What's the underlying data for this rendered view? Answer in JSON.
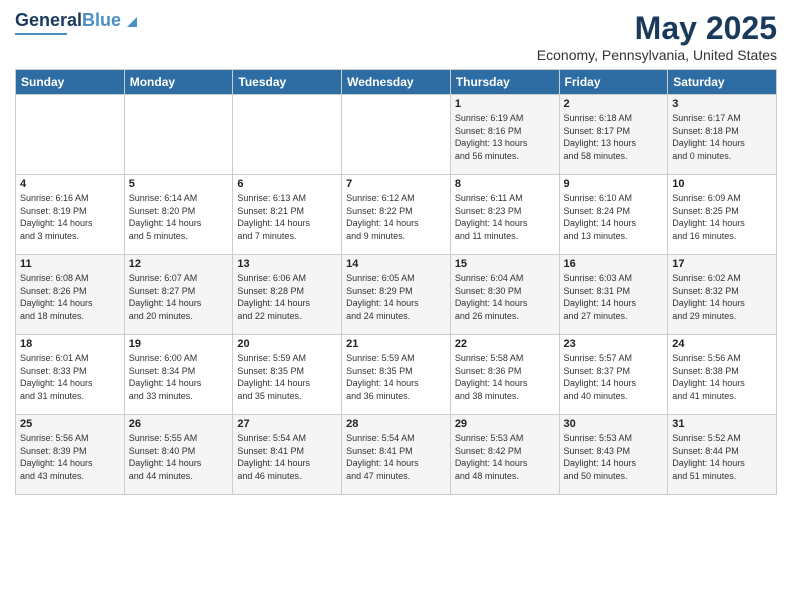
{
  "header": {
    "logo_general": "General",
    "logo_blue": "Blue",
    "month_title": "May 2025",
    "location": "Economy, Pennsylvania, United States"
  },
  "days_of_week": [
    "Sunday",
    "Monday",
    "Tuesday",
    "Wednesday",
    "Thursday",
    "Friday",
    "Saturday"
  ],
  "weeks": [
    [
      {
        "day": "",
        "info": ""
      },
      {
        "day": "",
        "info": ""
      },
      {
        "day": "",
        "info": ""
      },
      {
        "day": "",
        "info": ""
      },
      {
        "day": "1",
        "info": "Sunrise: 6:19 AM\nSunset: 8:16 PM\nDaylight: 13 hours\nand 56 minutes."
      },
      {
        "day": "2",
        "info": "Sunrise: 6:18 AM\nSunset: 8:17 PM\nDaylight: 13 hours\nand 58 minutes."
      },
      {
        "day": "3",
        "info": "Sunrise: 6:17 AM\nSunset: 8:18 PM\nDaylight: 14 hours\nand 0 minutes."
      }
    ],
    [
      {
        "day": "4",
        "info": "Sunrise: 6:16 AM\nSunset: 8:19 PM\nDaylight: 14 hours\nand 3 minutes."
      },
      {
        "day": "5",
        "info": "Sunrise: 6:14 AM\nSunset: 8:20 PM\nDaylight: 14 hours\nand 5 minutes."
      },
      {
        "day": "6",
        "info": "Sunrise: 6:13 AM\nSunset: 8:21 PM\nDaylight: 14 hours\nand 7 minutes."
      },
      {
        "day": "7",
        "info": "Sunrise: 6:12 AM\nSunset: 8:22 PM\nDaylight: 14 hours\nand 9 minutes."
      },
      {
        "day": "8",
        "info": "Sunrise: 6:11 AM\nSunset: 8:23 PM\nDaylight: 14 hours\nand 11 minutes."
      },
      {
        "day": "9",
        "info": "Sunrise: 6:10 AM\nSunset: 8:24 PM\nDaylight: 14 hours\nand 13 minutes."
      },
      {
        "day": "10",
        "info": "Sunrise: 6:09 AM\nSunset: 8:25 PM\nDaylight: 14 hours\nand 16 minutes."
      }
    ],
    [
      {
        "day": "11",
        "info": "Sunrise: 6:08 AM\nSunset: 8:26 PM\nDaylight: 14 hours\nand 18 minutes."
      },
      {
        "day": "12",
        "info": "Sunrise: 6:07 AM\nSunset: 8:27 PM\nDaylight: 14 hours\nand 20 minutes."
      },
      {
        "day": "13",
        "info": "Sunrise: 6:06 AM\nSunset: 8:28 PM\nDaylight: 14 hours\nand 22 minutes."
      },
      {
        "day": "14",
        "info": "Sunrise: 6:05 AM\nSunset: 8:29 PM\nDaylight: 14 hours\nand 24 minutes."
      },
      {
        "day": "15",
        "info": "Sunrise: 6:04 AM\nSunset: 8:30 PM\nDaylight: 14 hours\nand 26 minutes."
      },
      {
        "day": "16",
        "info": "Sunrise: 6:03 AM\nSunset: 8:31 PM\nDaylight: 14 hours\nand 27 minutes."
      },
      {
        "day": "17",
        "info": "Sunrise: 6:02 AM\nSunset: 8:32 PM\nDaylight: 14 hours\nand 29 minutes."
      }
    ],
    [
      {
        "day": "18",
        "info": "Sunrise: 6:01 AM\nSunset: 8:33 PM\nDaylight: 14 hours\nand 31 minutes."
      },
      {
        "day": "19",
        "info": "Sunrise: 6:00 AM\nSunset: 8:34 PM\nDaylight: 14 hours\nand 33 minutes."
      },
      {
        "day": "20",
        "info": "Sunrise: 5:59 AM\nSunset: 8:35 PM\nDaylight: 14 hours\nand 35 minutes."
      },
      {
        "day": "21",
        "info": "Sunrise: 5:59 AM\nSunset: 8:35 PM\nDaylight: 14 hours\nand 36 minutes."
      },
      {
        "day": "22",
        "info": "Sunrise: 5:58 AM\nSunset: 8:36 PM\nDaylight: 14 hours\nand 38 minutes."
      },
      {
        "day": "23",
        "info": "Sunrise: 5:57 AM\nSunset: 8:37 PM\nDaylight: 14 hours\nand 40 minutes."
      },
      {
        "day": "24",
        "info": "Sunrise: 5:56 AM\nSunset: 8:38 PM\nDaylight: 14 hours\nand 41 minutes."
      }
    ],
    [
      {
        "day": "25",
        "info": "Sunrise: 5:56 AM\nSunset: 8:39 PM\nDaylight: 14 hours\nand 43 minutes."
      },
      {
        "day": "26",
        "info": "Sunrise: 5:55 AM\nSunset: 8:40 PM\nDaylight: 14 hours\nand 44 minutes."
      },
      {
        "day": "27",
        "info": "Sunrise: 5:54 AM\nSunset: 8:41 PM\nDaylight: 14 hours\nand 46 minutes."
      },
      {
        "day": "28",
        "info": "Sunrise: 5:54 AM\nSunset: 8:41 PM\nDaylight: 14 hours\nand 47 minutes."
      },
      {
        "day": "29",
        "info": "Sunrise: 5:53 AM\nSunset: 8:42 PM\nDaylight: 14 hours\nand 48 minutes."
      },
      {
        "day": "30",
        "info": "Sunrise: 5:53 AM\nSunset: 8:43 PM\nDaylight: 14 hours\nand 50 minutes."
      },
      {
        "day": "31",
        "info": "Sunrise: 5:52 AM\nSunset: 8:44 PM\nDaylight: 14 hours\nand 51 minutes."
      }
    ]
  ]
}
